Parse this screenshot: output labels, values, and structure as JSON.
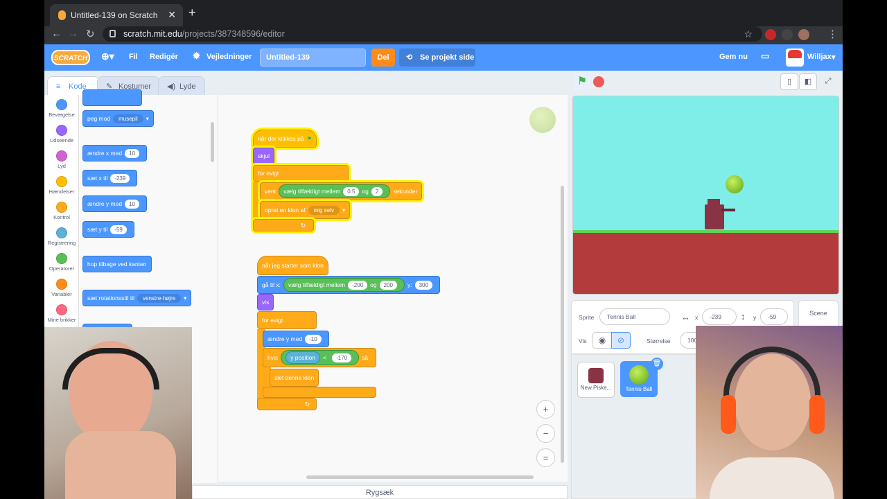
{
  "browser": {
    "tab_title": "Untitled-139 on Scratch",
    "tab_close": "✕",
    "new_tab": "+",
    "url_host": "scratch.mit.edu",
    "url_path": "/projects/387348596/editor"
  },
  "menu": {
    "logo": "SCRATCH",
    "language_icon": "globe-icon",
    "file": "Fil",
    "edit": "Redigér",
    "tutorials": "Vejledninger",
    "project_title": "Untitled-139",
    "share": "Del",
    "see_project": "Se projekt side",
    "save_now": "Gem nu",
    "username": "Willjax",
    "brand_color": "#4c97ff"
  },
  "tabs": {
    "code": "Kode",
    "costumes": "Kostumer",
    "sounds": "Lyde"
  },
  "categories": [
    {
      "label": "Bevægelse",
      "color": "#4c97ff"
    },
    {
      "label": "Udseende",
      "color": "#9966ff"
    },
    {
      "label": "Lyd",
      "color": "#cf63cf"
    },
    {
      "label": "Hændelser",
      "color": "#ffbf00"
    },
    {
      "label": "Kontrol",
      "color": "#ffab19"
    },
    {
      "label": "Registrering",
      "color": "#5cb1d6"
    },
    {
      "label": "Operatorer",
      "color": "#59c059"
    },
    {
      "label": "Variabler",
      "color": "#ff8c1a"
    },
    {
      "label": "Mine brikker",
      "color": "#ff6680"
    }
  ],
  "palette": {
    "point_towards": "peg mod",
    "point_target": "musepil",
    "change_x": "ændre x med",
    "change_x_val": "10",
    "set_x": "sæt x til",
    "set_x_val": "-239",
    "change_y": "ændre y med",
    "change_y_val": "10",
    "set_y": "sæt y til",
    "set_y_val": "-59",
    "bounce": "hop tilbage ved kanten",
    "rotation_style": "sæt rotationsstil til",
    "rotation_val": "venstre-højre"
  },
  "script1": {
    "hat": "når der klikkes på",
    "hide": "skjul",
    "forever": "for evigt",
    "wait": "vent",
    "random": "vælg tilfældigt mellem",
    "rand_from": "0.5",
    "and": "og",
    "rand_to": "2",
    "seconds": "sekunder",
    "create_clone": "opret en klon af",
    "clone_target": "mig selv"
  },
  "script2": {
    "hat": "når jeg starter som klon",
    "goto": "gå til x:",
    "random": "vælg tilfældigt mellem",
    "rand_from": "-200",
    "and": "og",
    "rand_to": "200",
    "y_label": "y:",
    "y_val": "300",
    "show": "vis",
    "forever": "for evigt",
    "change_y": "ændre y med",
    "change_y_val": "-10",
    "if": "hvis",
    "y_position": "y position",
    "lt": "<",
    "compare_val": "-170",
    "then": "så",
    "delete_clone": "slet denne klon"
  },
  "zoom": {
    "in": "+",
    "out": "−",
    "reset": "="
  },
  "backpack": "Rygsæk",
  "sprite_info": {
    "sprite_label": "Sprite",
    "sprite_name": "Tennis Ball",
    "x_label": "x",
    "x_val": "-239",
    "y_label": "y",
    "y_val": "-59",
    "show_label": "Vis",
    "size_label": "Størrelse",
    "size_val": "100"
  },
  "scene_label": "Scene",
  "sprites": [
    {
      "name": "New Piske...",
      "selected": false
    },
    {
      "name": "Tennis Ball",
      "selected": true
    }
  ]
}
